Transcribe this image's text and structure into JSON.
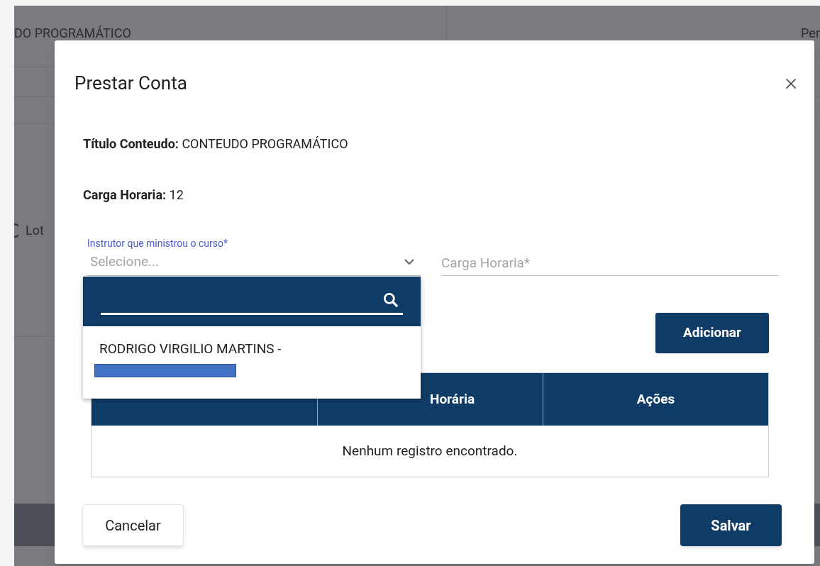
{
  "background": {
    "column_heading": "DO PROGRAMÁTICO",
    "column_heading_2": "Per",
    "radio_label": "Lot"
  },
  "dialog": {
    "title": "Prestar Conta",
    "close": "×",
    "info": [
      {
        "label": "Título Conteudo:",
        "value": "CONTEUDO PROGRAMÁTICO"
      },
      {
        "label": "Carga Horaria:",
        "value": "12"
      }
    ],
    "instructor_select": {
      "label": "Instrutor que ministrou o curso*",
      "placeholder": "Selecione...",
      "expanded": true,
      "options": [
        {
          "text": "RODRIGO VIRGILIO MARTINS -",
          "redacted": true
        }
      ]
    },
    "hours_field": {
      "placeholder": "Carga Horaria*"
    },
    "add_button": "Adicionar",
    "table": {
      "columns": [
        {
          "kind": "covered"
        },
        {
          "kind": "partly_covered",
          "label": "Horária"
        },
        {
          "kind": "plain",
          "label": "Ações"
        }
      ],
      "empty_message": "Nenhum registro encontrado."
    },
    "buttons": [
      {
        "label": "Cancelar",
        "kind": "secondary"
      },
      {
        "label": "Salvar",
        "kind": "primary"
      }
    ]
  }
}
